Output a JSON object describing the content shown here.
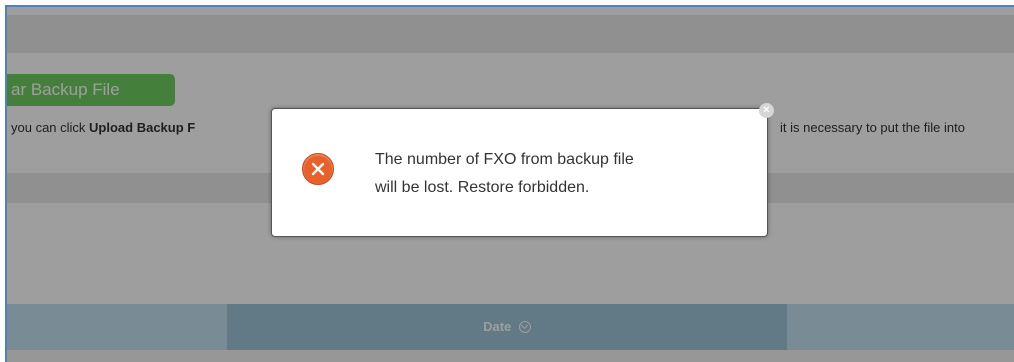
{
  "page": {
    "backup_button_label": "ar Backup File",
    "info_text_prefix": "you can click ",
    "info_text_bold": "Upload Backup F",
    "info_text_right": "it is necessary to put the file into",
    "table": {
      "columns": [
        {
          "label": "Date"
        }
      ]
    }
  },
  "dialog": {
    "message_line1": "The number of FXO from backup file",
    "message_line2": "will be lost. Restore forbidden.",
    "close_symbol": "×",
    "icon": "error-x-icon"
  },
  "colors": {
    "frame_border": "#4f81bd",
    "button_green": "#6fcf62",
    "table_header": "#c4e0ef",
    "date_column": "#9fc4d8",
    "error_icon": "#e8602a"
  }
}
